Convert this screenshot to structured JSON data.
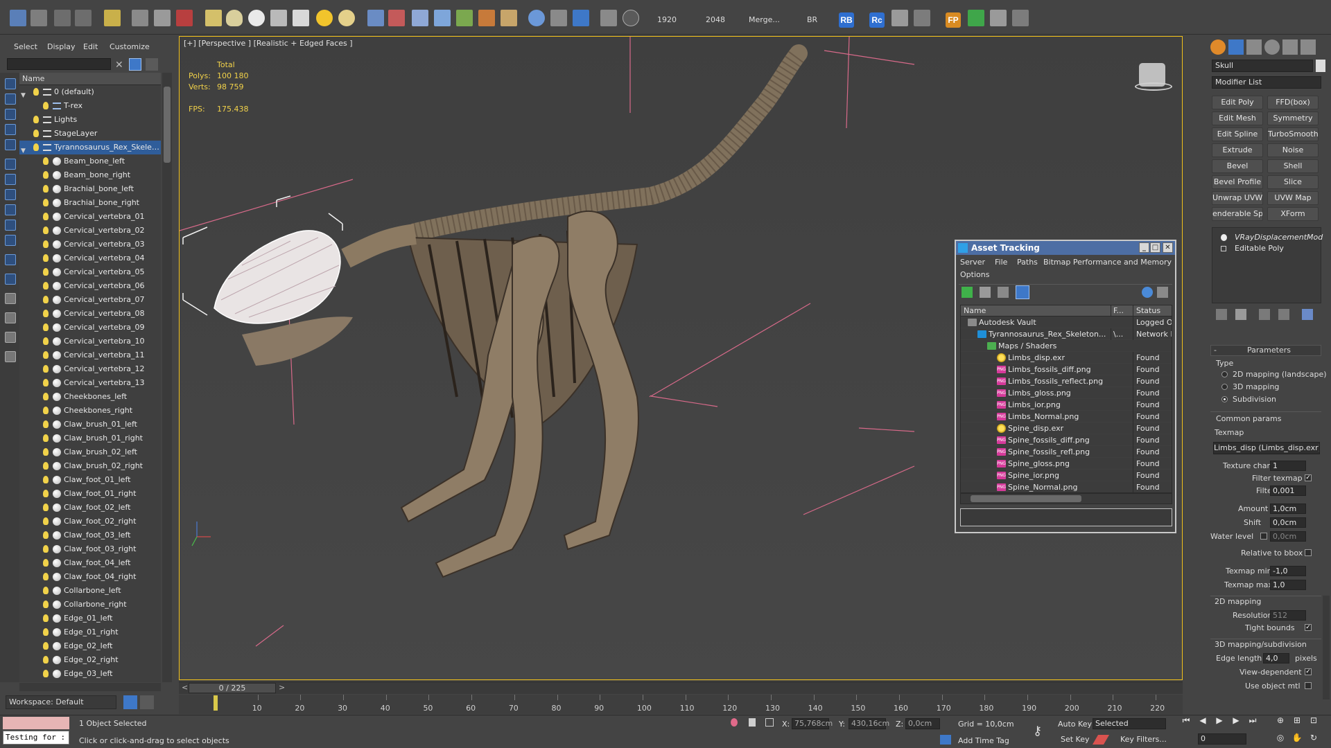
{
  "toolbar": {
    "render_width": "1920",
    "render_height": "2048",
    "merge_label": "Merge...",
    "br_label": "BR",
    "rb_badge": "RB",
    "rc_badge": "Rc",
    "fp_badge": "FP"
  },
  "explorer": {
    "menu": [
      "Select",
      "Display",
      "Edit",
      "Customize"
    ],
    "column_name": "Name",
    "items": [
      {
        "label": "0 (default)",
        "indent": 1,
        "type": "layer",
        "expand": true
      },
      {
        "label": "T-rex",
        "indent": 2,
        "type": "object"
      },
      {
        "label": "Lights",
        "indent": 1,
        "type": "layer"
      },
      {
        "label": "StageLayer",
        "indent": 1,
        "type": "layer"
      },
      {
        "label": "Tyrannosaurus_Rex_Skele…",
        "indent": 1,
        "type": "layer",
        "expand": true,
        "selected": true
      },
      {
        "label": "Beam_bone_left",
        "indent": 2,
        "type": "sphere"
      },
      {
        "label": "Beam_bone_right",
        "indent": 2,
        "type": "sphere"
      },
      {
        "label": "Brachial_bone_left",
        "indent": 2,
        "type": "sphere"
      },
      {
        "label": "Brachial_bone_right",
        "indent": 2,
        "type": "sphere"
      },
      {
        "label": "Cervical_vertebra_01",
        "indent": 2,
        "type": "sphere"
      },
      {
        "label": "Cervical_vertebra_02",
        "indent": 2,
        "type": "sphere"
      },
      {
        "label": "Cervical_vertebra_03",
        "indent": 2,
        "type": "sphere"
      },
      {
        "label": "Cervical_vertebra_04",
        "indent": 2,
        "type": "sphere"
      },
      {
        "label": "Cervical_vertebra_05",
        "indent": 2,
        "type": "sphere"
      },
      {
        "label": "Cervical_vertebra_06",
        "indent": 2,
        "type": "sphere"
      },
      {
        "label": "Cervical_vertebra_07",
        "indent": 2,
        "type": "sphere"
      },
      {
        "label": "Cervical_vertebra_08",
        "indent": 2,
        "type": "sphere"
      },
      {
        "label": "Cervical_vertebra_09",
        "indent": 2,
        "type": "sphere"
      },
      {
        "label": "Cervical_vertebra_10",
        "indent": 2,
        "type": "sphere"
      },
      {
        "label": "Cervical_vertebra_11",
        "indent": 2,
        "type": "sphere"
      },
      {
        "label": "Cervical_vertebra_12",
        "indent": 2,
        "type": "sphere"
      },
      {
        "label": "Cervical_vertebra_13",
        "indent": 2,
        "type": "sphere"
      },
      {
        "label": "Cheekbones_left",
        "indent": 2,
        "type": "sphere"
      },
      {
        "label": "Cheekbones_right",
        "indent": 2,
        "type": "sphere"
      },
      {
        "label": "Claw_brush_01_left",
        "indent": 2,
        "type": "sphere"
      },
      {
        "label": "Claw_brush_01_right",
        "indent": 2,
        "type": "sphere"
      },
      {
        "label": "Claw_brush_02_left",
        "indent": 2,
        "type": "sphere"
      },
      {
        "label": "Claw_brush_02_right",
        "indent": 2,
        "type": "sphere"
      },
      {
        "label": "Claw_foot_01_left",
        "indent": 2,
        "type": "sphere"
      },
      {
        "label": "Claw_foot_01_right",
        "indent": 2,
        "type": "sphere"
      },
      {
        "label": "Claw_foot_02_left",
        "indent": 2,
        "type": "sphere"
      },
      {
        "label": "Claw_foot_02_right",
        "indent": 2,
        "type": "sphere"
      },
      {
        "label": "Claw_foot_03_left",
        "indent": 2,
        "type": "sphere"
      },
      {
        "label": "Claw_foot_03_right",
        "indent": 2,
        "type": "sphere"
      },
      {
        "label": "Claw_foot_04_left",
        "indent": 2,
        "type": "sphere"
      },
      {
        "label": "Claw_foot_04_right",
        "indent": 2,
        "type": "sphere"
      },
      {
        "label": "Collarbone_left",
        "indent": 2,
        "type": "sphere"
      },
      {
        "label": "Collarbone_right",
        "indent": 2,
        "type": "sphere"
      },
      {
        "label": "Edge_01_left",
        "indent": 2,
        "type": "sphere"
      },
      {
        "label": "Edge_01_right",
        "indent": 2,
        "type": "sphere"
      },
      {
        "label": "Edge_02_left",
        "indent": 2,
        "type": "sphere"
      },
      {
        "label": "Edge_02_right",
        "indent": 2,
        "type": "sphere"
      },
      {
        "label": "Edge_03_left",
        "indent": 2,
        "type": "sphere"
      }
    ],
    "workspace": "Workspace: Default"
  },
  "viewport": {
    "label": "[+] [Perspective ] [Realistic + Edged Faces ]",
    "stats_total": "Total",
    "polys_label": "Polys:",
    "polys_value": "100 180",
    "verts_label": "Verts:",
    "verts_value": "98 759",
    "fps_label": "FPS:",
    "fps_value": "175.438"
  },
  "asset_tracking": {
    "title": "Asset Tracking",
    "menu": [
      "Server",
      "File",
      "Paths",
      "Bitmap Performance and Memory",
      "Options"
    ],
    "columns": [
      "Name",
      "F...",
      "Status"
    ],
    "rows": [
      {
        "name": "Autodesk Vault",
        "f": "",
        "status": "Logged O",
        "indent": 0,
        "icon": "vault"
      },
      {
        "name": "Tyrannosaurus_Rex_Skeleton...",
        "f": "\\...",
        "status": "Network P",
        "indent": 1,
        "icon": "max"
      },
      {
        "name": "Maps / Shaders",
        "f": "",
        "status": "",
        "indent": 2,
        "icon": "folder"
      },
      {
        "name": "Limbs_disp.exr",
        "f": "",
        "status": "Found",
        "indent": 3,
        "icon": "exr"
      },
      {
        "name": "Limbs_fossils_diff.png",
        "f": "",
        "status": "Found",
        "indent": 3,
        "icon": "png"
      },
      {
        "name": "Limbs_fossils_reflect.png",
        "f": "",
        "status": "Found",
        "indent": 3,
        "icon": "png"
      },
      {
        "name": "Limbs_gloss.png",
        "f": "",
        "status": "Found",
        "indent": 3,
        "icon": "png"
      },
      {
        "name": "Limbs_ior.png",
        "f": "",
        "status": "Found",
        "indent": 3,
        "icon": "png"
      },
      {
        "name": "Limbs_Normal.png",
        "f": "",
        "status": "Found",
        "indent": 3,
        "icon": "png"
      },
      {
        "name": "Spine_disp.exr",
        "f": "",
        "status": "Found",
        "indent": 3,
        "icon": "exr"
      },
      {
        "name": "Spine_fossils_diff.png",
        "f": "",
        "status": "Found",
        "indent": 3,
        "icon": "png"
      },
      {
        "name": "Spine_fossils_refl.png",
        "f": "",
        "status": "Found",
        "indent": 3,
        "icon": "png"
      },
      {
        "name": "Spine_gloss.png",
        "f": "",
        "status": "Found",
        "indent": 3,
        "icon": "png"
      },
      {
        "name": "Spine_ior.png",
        "f": "",
        "status": "Found",
        "indent": 3,
        "icon": "png"
      },
      {
        "name": "Spine_Normal.png",
        "f": "",
        "status": "Found",
        "indent": 3,
        "icon": "png"
      }
    ]
  },
  "command_panel": {
    "object_name": "Skull",
    "modifier_list": "Modifier List",
    "modifier_buttons": [
      "Edit Poly",
      "FFD(box)",
      "Edit Mesh",
      "Symmetry",
      "Edit Spline",
      "TurboSmooth",
      "Extrude",
      "Noise",
      "Bevel",
      "Shell",
      "Bevel Profile",
      "Slice",
      "Unwrap UVW",
      "UVW Map",
      "enderable Splir",
      "XForm"
    ],
    "stack": [
      "VRayDisplacementMod",
      "Editable Poly"
    ],
    "parameters_title": "Parameters",
    "type_label": "Type",
    "type_options": [
      "2D mapping (landscape)",
      "3D mapping",
      "Subdivision"
    ],
    "type_selected": 2,
    "common_params": "Common params",
    "texmap_label": "Texmap",
    "texmap_value": "Limbs_disp (Limbs_disp.exr)",
    "texture_chan_label": "Texture chan",
    "texture_chan_value": "1",
    "filter_texmap_label": "Filter texmap",
    "filter_blur_label": "Filter blur",
    "filter_blur_value": "0,001",
    "amount_label": "Amount",
    "amount_value": "1,0cm",
    "shift_label": "Shift",
    "shift_value": "0,0cm",
    "water_level_label": "Water level",
    "water_level_value": "0,0cm",
    "relative_bbox_label": "Relative to bbox",
    "texmap_min_label": "Texmap min",
    "texmap_min_value": "-1,0",
    "texmap_max_label": "Texmap max",
    "texmap_max_value": "1,0",
    "mapping2d_title": "2D mapping",
    "resolution_label": "Resolution",
    "resolution_value": "512",
    "tight_bounds_label": "Tight bounds",
    "mapping3d_title": "3D mapping/subdivision",
    "edge_length_label": "Edge length",
    "edge_length_value": "4,0",
    "pixels_label": "pixels",
    "view_dependent_label": "View-dependent",
    "use_object_mtl_label": "Use object mtl"
  },
  "timeline": {
    "frame": "0 / 225",
    "ticks": [
      "10",
      "20",
      "30",
      "40",
      "50",
      "60",
      "70",
      "80",
      "90",
      "100",
      "110",
      "120",
      "130",
      "140",
      "150",
      "160",
      "170",
      "180",
      "190",
      "200",
      "210",
      "220"
    ]
  },
  "status": {
    "script_text": "Testing for :",
    "selection": "1 Object Selected",
    "prompt": "Click or click-and-drag to select objects",
    "x_label": "X:",
    "x_value": "75,768cm",
    "y_label": "Y:",
    "y_value": "430,16cm",
    "z_label": "Z:",
    "z_value": "0,0cm",
    "grid": "Grid = 10,0cm",
    "add_time_tag": "Add Time Tag",
    "auto_key": "Auto Key",
    "set_key": "Set Key",
    "key_mode": "Selected",
    "key_filters": "Key Filters...",
    "frame_field": "0"
  }
}
